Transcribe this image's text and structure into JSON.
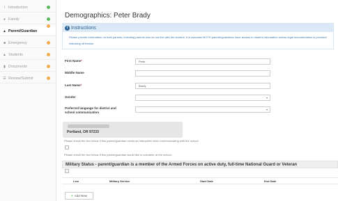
{
  "sidebar": {
    "items": [
      {
        "label": "Introduction",
        "icon": "info-icon",
        "status": "complete"
      },
      {
        "label": "Family",
        "icon": "users-icon",
        "status": "complete"
      },
      {
        "label": "Parent/Guardian",
        "icon": "person-icon",
        "status": "active"
      },
      {
        "label": "Emergency",
        "icon": "contacts-icon",
        "status": "warning"
      },
      {
        "label": "Students",
        "icon": "graduation-cap-icon",
        "status": "warning"
      },
      {
        "label": "Documents",
        "icon": "document-icon",
        "status": "warning"
      },
      {
        "label": "Review/Submit",
        "icon": "list-icon",
        "status": "warning"
      }
    ]
  },
  "page": {
    "title": "Demographics: Peter Brady"
  },
  "instructions": {
    "heading": "Instructions",
    "text": "Please provide information on both parents, including parents who do not live with the student. It is assumed BOTH parents/guardians have access to student information unless legal documentation is provided indicating otherwise."
  },
  "form": {
    "first_name_label": "First Name",
    "first_name_value": "Peter",
    "middle_name_label": "Middle Name",
    "middle_name_value": "",
    "last_name_label": "Last Name",
    "last_name_value": "Brady",
    "gender_label": "Gender",
    "gender_value": "",
    "language_label_line1": "Preferred language for district and",
    "language_label_line2": "school communication",
    "language_value": "",
    "required_marker": "*",
    "select_caret": "▾"
  },
  "address": {
    "city_line": "Portland, OR 97233"
  },
  "interpreter": {
    "note": "Please check the box below if this parent/guardian needs an interpreter when communicating with the school."
  },
  "volunteer": {
    "note": "Please check the box below if this parent/guardian would like to volunteer at the school."
  },
  "military": {
    "heading": "Military Status - parent/guardian is a member of the Armed Forces on active duty, full-time National Guard or Veteran",
    "columns": [
      "Line",
      "Military Service",
      "Start Date",
      "End Date"
    ],
    "add_button": "Add New"
  },
  "colors": {
    "status_complete": "#5cb85c",
    "status_warning": "#f0ad4e",
    "instructions_bg": "#dbe9f6",
    "instructions_text": "#3a7ab5",
    "required": "#d9534f"
  }
}
